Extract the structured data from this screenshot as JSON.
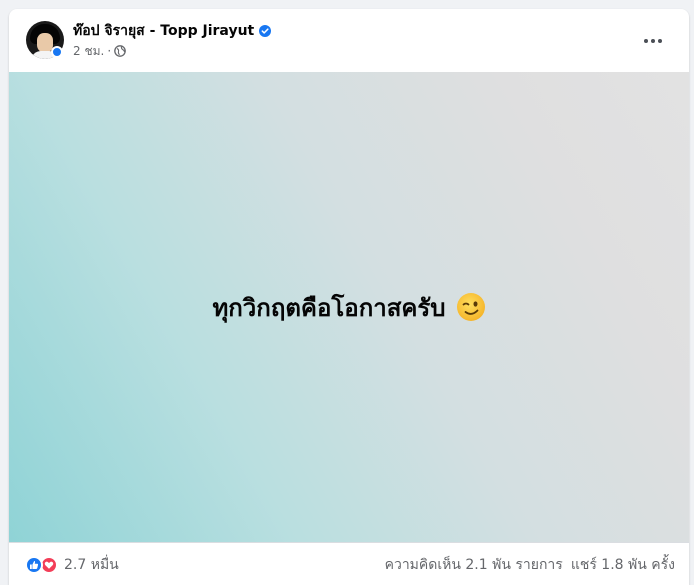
{
  "post": {
    "author": "ท๊อป จิรายุส - Topp Jirayut",
    "time": "2 ชม.",
    "separator": "·",
    "privacy_icon": "globe-icon",
    "verified_icon": "verified-badge-icon",
    "content_text": "ทุกวิกฤตคือโอกาสครับ",
    "content_emoji": "winking-face-emoji",
    "more_icon": "more-options-icon"
  },
  "footer": {
    "reaction_icons": [
      "like-reaction-icon",
      "love-reaction-icon"
    ],
    "reaction_count": "2.7 หมื่น",
    "comments": "ความคิดเห็น 2.1 พัน รายการ",
    "shares": "แชร์ 1.8 พัน ครั้ง"
  },
  "colors": {
    "accent": "#1877f2",
    "love": "#f33e58",
    "meta_text": "#65676b",
    "bg_gradient_start": "#8fd3d6",
    "bg_gradient_end": "#e2e2e2"
  }
}
